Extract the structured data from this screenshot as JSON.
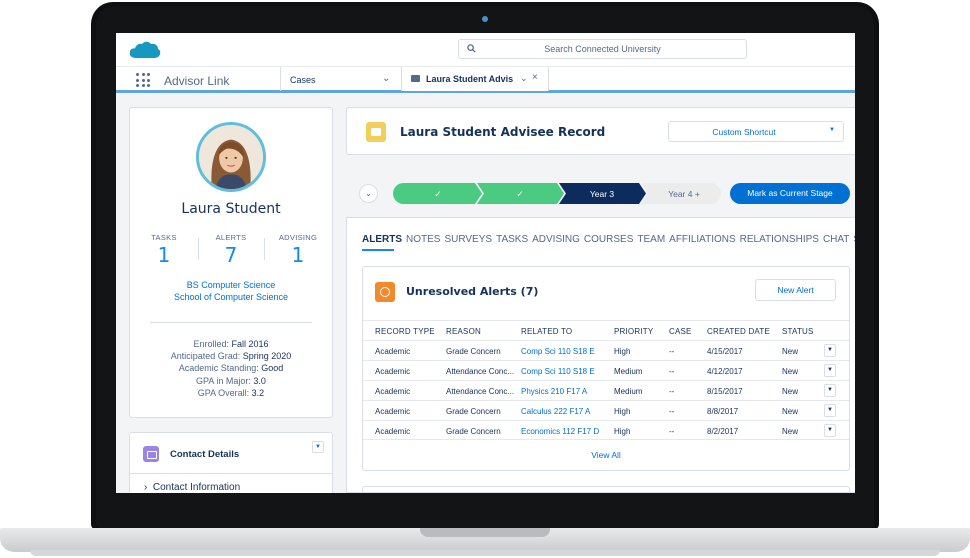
{
  "header": {
    "search_placeholder": "Search Connected University"
  },
  "nav": {
    "app_name": "Advisor Link",
    "object_tab": "Cases",
    "active_tab": "Laura Student Advis"
  },
  "profile": {
    "name": "Laura Student",
    "stats": [
      {
        "label": "TASKS",
        "value": "1"
      },
      {
        "label": "ALERTS",
        "value": "7"
      },
      {
        "label": "ADVISING",
        "value": "1"
      }
    ],
    "degree": "BS Computer Science",
    "school": "School of Computer Science",
    "facts": [
      {
        "label": "Enrolled:",
        "value": "Fall 2016"
      },
      {
        "label": "Anticipated Grad:",
        "value": "Spring 2020"
      },
      {
        "label": "Academic Standing:",
        "value": "Good"
      },
      {
        "label": "GPA in Major:",
        "value": "3.0"
      },
      {
        "label": "GPA Overall:",
        "value": "3.2"
      }
    ]
  },
  "contact": {
    "title": "Contact Details",
    "section": "Contact Information"
  },
  "record": {
    "title": "Laura Student Advisee Record",
    "shortcut": "Custom Shortcut"
  },
  "path": {
    "stages": [
      {
        "label": "✓",
        "status": "complete"
      },
      {
        "label": "✓",
        "status": "complete"
      },
      {
        "label": "Year 3",
        "status": "current"
      },
      {
        "label": "Year 4 +",
        "status": "upcoming"
      }
    ],
    "button": "Mark as Current Stage"
  },
  "tabs": [
    "ALERTS",
    "NOTES",
    "SURVEYS",
    "TASKS",
    "ADVISING",
    "COURSES",
    "TEAM",
    "AFFILIATIONS",
    "RELATIONSHIPS",
    "CHAT",
    "SOCIAL"
  ],
  "alerts": {
    "title": "Unresolved Alerts (7)",
    "new_button": "New Alert",
    "columns": [
      "RECORD TYPE",
      "REASON",
      "RELATED TO",
      "PRIORITY",
      "CASE",
      "CREATED DATE",
      "STATUS"
    ],
    "rows": [
      [
        "Academic",
        "Grade Concern",
        "Comp Sci 110 S18 E",
        "High",
        "--",
        "4/15/2017",
        "New"
      ],
      [
        "Academic",
        "Attendance Conc...",
        "Comp Sci 110 S18 E",
        "Medium",
        "--",
        "4/12/2017",
        "New"
      ],
      [
        "Academic",
        "Attendance Conc...",
        "Physics 210 F17 A",
        "Medium",
        "--",
        "8/15/2017",
        "New"
      ],
      [
        "Academic",
        "Grade Concern",
        "Calculus 222 F17 A",
        "High",
        "--",
        "8/8/2017",
        "New"
      ],
      [
        "Academic",
        "Grade Concern",
        "Economics 112 F17 D",
        "High",
        "--",
        "8/2/2017",
        "New"
      ]
    ],
    "view_all": "View All"
  },
  "colors": {
    "brand": "#1798c1",
    "accent": "#0070d2",
    "path_complete": "#4bca81",
    "path_current": "#0b2c5c"
  }
}
